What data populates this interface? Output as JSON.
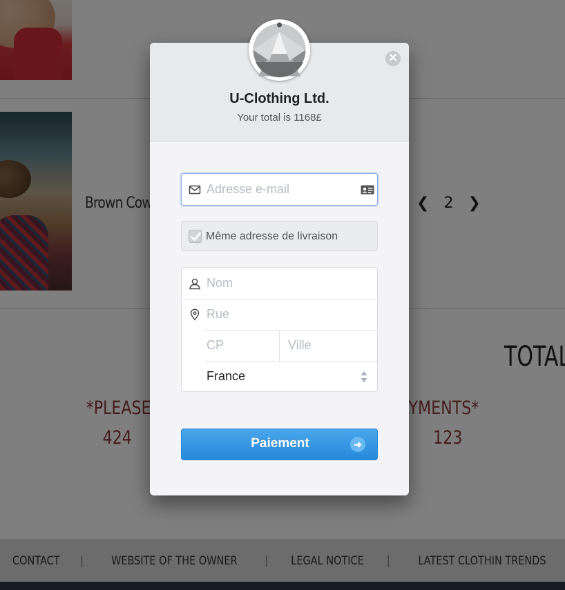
{
  "background": {
    "product_name": "Brown Cowb",
    "pager": {
      "prev": "❮",
      "page": "2",
      "next": "❯"
    },
    "total_heading": "TOTAL",
    "notice_line_1": "*PLEASE USE T                                    R PAYMENTS*",
    "notice_line_2": "424                                                              123",
    "footer_links": [
      "CONTACT",
      "WEBSITE OF THE OWNER",
      "LEGAL NOTICE",
      "LATEST CLOTHIN TRENDS"
    ],
    "footer_separator": "|"
  },
  "checkout": {
    "merchant_name": "U-Clothing Ltd.",
    "total_text": "Your total is 1168£",
    "close_glyph": "✕",
    "email": {
      "placeholder": "Adresse e-mail",
      "value": "",
      "icon": "mail-icon",
      "right_icon": "id-card-icon"
    },
    "same_shipping": {
      "label": "Même adresse de livraison",
      "checked": true
    },
    "name": {
      "placeholder": "Nom",
      "icon": "user-icon"
    },
    "street": {
      "placeholder": "Rue",
      "icon": "location-pin-icon"
    },
    "postal_code": {
      "placeholder": "CP"
    },
    "city": {
      "placeholder": "Ville"
    },
    "country": {
      "selected": "France"
    },
    "pay_button": {
      "label": "Paiement",
      "arrow": "➜"
    }
  },
  "colors": {
    "accent_blue": "#2689da",
    "notice_red": "#8a3a3a",
    "overlay": "rgba(0,0,0,0.5)"
  }
}
